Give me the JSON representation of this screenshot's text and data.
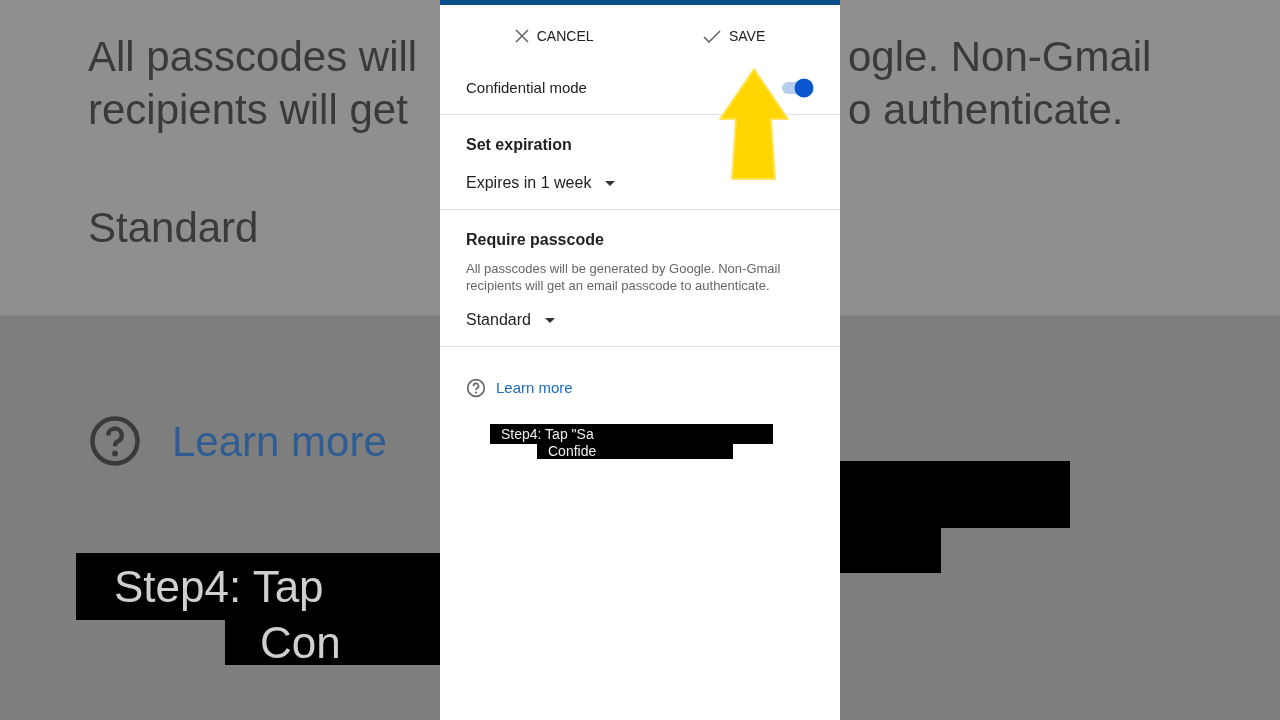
{
  "background": {
    "left_lines": [
      "All passcodes will",
      "recipients will get"
    ],
    "right_lines": [
      "ogle. Non-Gmail",
      "o authenticate."
    ],
    "left_value": "Standard",
    "left_link": "Learn more",
    "left_caption": [
      "Step4: Tap",
      "Con"
    ]
  },
  "toolbar": {
    "cancel": "CANCEL",
    "save": "SAVE"
  },
  "confidential_mode": {
    "label": "Confidential mode",
    "on": true
  },
  "sections": [
    {
      "title": "Set expiration",
      "value": "Expires in 1 week"
    },
    {
      "title": "Require passcode",
      "description": "All passcodes will be generated by Google. Non-Gmail recipients will get an email passcode to authenticate.",
      "value": "Standard"
    }
  ],
  "learn_more": "Learn more",
  "caption": [
    "Step4: Tap \"Sa",
    "Confide"
  ]
}
